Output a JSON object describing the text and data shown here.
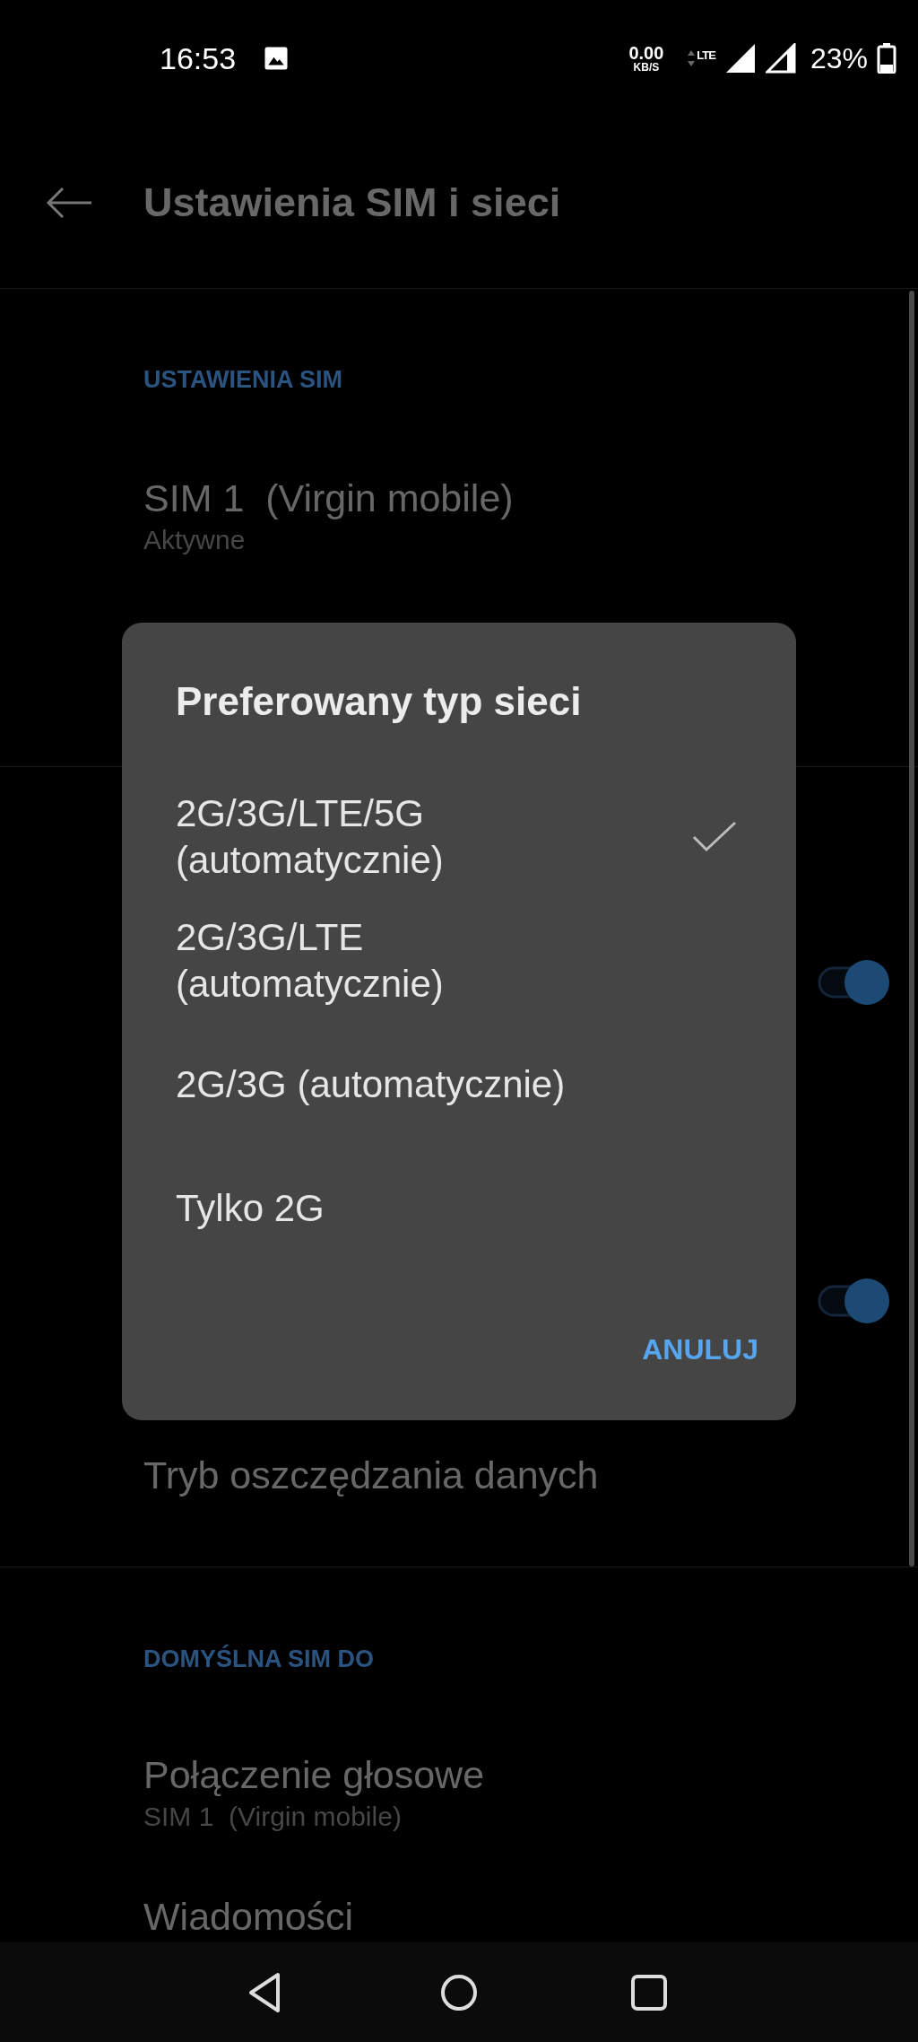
{
  "status_bar": {
    "time": "16:53",
    "data_speed": "0.00",
    "data_unit": "KB/S",
    "network": "LTE",
    "battery": "23%"
  },
  "header": {
    "title": "Ustawienia SIM i sieci"
  },
  "sections": [
    {
      "kind": "sim",
      "label": "USTAWIENIA SIM",
      "items": [
        {
          "kind": "entry",
          "title": "SIM 1  (Virgin mobile)",
          "subtitle": "Aktywne"
        }
      ]
    },
    {
      "kind": "plain",
      "items": [
        {
          "kind": "toggle",
          "on": true
        },
        {
          "kind": "toggle",
          "on": true
        },
        {
          "kind": "entry",
          "title": "Tryb oszczędzania danych"
        }
      ]
    },
    {
      "kind": "defaults",
      "label": "DOMYŚLNA SIM DO",
      "items": [
        {
          "kind": "entry",
          "title": "Połączenie głosowe",
          "subtitle": "SIM 1  (Virgin mobile)"
        },
        {
          "kind": "entry",
          "title": "Wiadomości"
        }
      ]
    }
  ],
  "dialog": {
    "title": "Preferowany typ sieci",
    "options": [
      {
        "label": "2G/3G/LTE/5G (automatycznie)",
        "selected": true
      },
      {
        "label": "2G/3G/LTE (automatycznie)",
        "selected": false
      },
      {
        "label": "2G/3G (automatycznie)",
        "selected": false
      },
      {
        "label": "Tylko 2G",
        "selected": false
      }
    ],
    "button": "ANULUJ"
  }
}
